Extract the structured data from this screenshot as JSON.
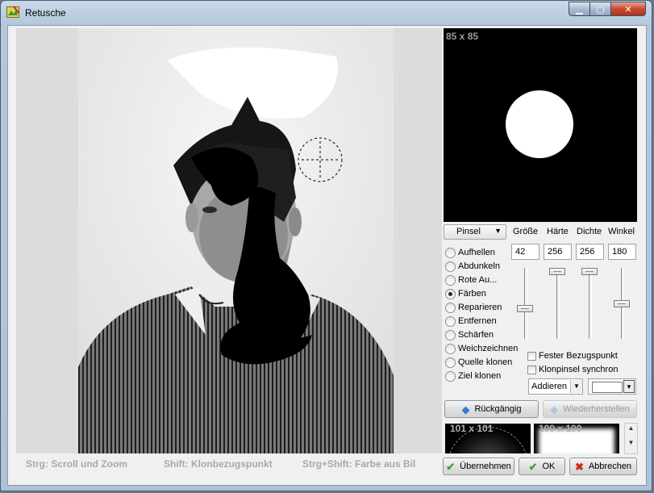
{
  "window": {
    "title": "Retusche"
  },
  "preview": {
    "size_label": "85 x 85"
  },
  "tool": {
    "selected": "Pinsel"
  },
  "params": {
    "labels": [
      "Größe",
      "Härte",
      "Dichte",
      "Winkel"
    ],
    "values": [
      "42",
      "256",
      "256",
      "180"
    ]
  },
  "modes": [
    {
      "label": "Aufhellen",
      "selected": false
    },
    {
      "label": "Abdunkeln",
      "selected": false
    },
    {
      "label": "Rote Au...",
      "selected": false
    },
    {
      "label": "Färben",
      "selected": true
    },
    {
      "label": "Reparieren",
      "selected": false
    },
    {
      "label": "Entfernen",
      "selected": false
    },
    {
      "label": "Schärfen",
      "selected": false
    },
    {
      "label": "Weichzeichnen",
      "selected": false
    },
    {
      "label": "Quelle klonen",
      "selected": false
    },
    {
      "label": "Ziel klonen",
      "selected": false
    }
  ],
  "sliders": {
    "groesse": 0.42,
    "haerte": 1.0,
    "dichte": 1.0,
    "winkel": 0.5
  },
  "options": {
    "fixed_ref": "Fester Bezugspunkt",
    "clone_sync": "Klonpinsel synchron",
    "blend_mode": "Addieren",
    "blend_color": "#ffffff"
  },
  "history": {
    "undo": "Rückgängig",
    "redo": "Wiederherstellen"
  },
  "brush_presets": [
    "101 x 101",
    "100 x 100"
  ],
  "status": {
    "hint1": "Strg: Scroll und Zoom",
    "hint2": "Shift: Klonbezugspunkt",
    "hint3": "Strg+Shift: Farbe aus Bil"
  },
  "buttons": {
    "apply": "Übernehmen",
    "ok": "OK",
    "cancel": "Abbrechen"
  }
}
